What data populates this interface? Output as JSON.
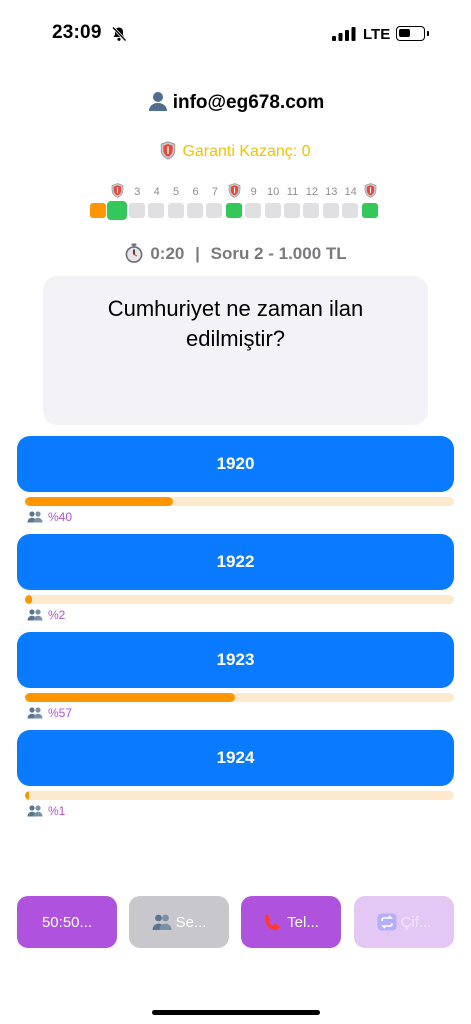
{
  "status_bar": {
    "time": "23:09",
    "network": "LTE"
  },
  "header": {
    "user_email": "info@eg678.com",
    "guarantee_text": "Garanti Kazanç: 0"
  },
  "ladder": {
    "levels": [
      {
        "label": "",
        "state": "done",
        "safe": false
      },
      {
        "label": "",
        "state": "current",
        "safe": true
      },
      {
        "label": "3",
        "state": "pending",
        "safe": false
      },
      {
        "label": "4",
        "state": "pending",
        "safe": false
      },
      {
        "label": "5",
        "state": "pending",
        "safe": false
      },
      {
        "label": "6",
        "state": "pending",
        "safe": false
      },
      {
        "label": "7",
        "state": "pending",
        "safe": false
      },
      {
        "label": "",
        "state": "safe",
        "safe": true
      },
      {
        "label": "9",
        "state": "pending",
        "safe": false
      },
      {
        "label": "10",
        "state": "pending",
        "safe": false
      },
      {
        "label": "11",
        "state": "pending",
        "safe": false
      },
      {
        "label": "12",
        "state": "pending",
        "safe": false
      },
      {
        "label": "13",
        "state": "pending",
        "safe": false
      },
      {
        "label": "14",
        "state": "pending",
        "safe": false
      },
      {
        "label": "",
        "state": "safe",
        "safe": true
      }
    ]
  },
  "timer": {
    "time": "0:20",
    "separator": "|",
    "question_info": "Soru 2 - 1.000 TL"
  },
  "question": {
    "text": "Cumhuriyet ne zaman ilan edilmiştir?"
  },
  "answers": [
    {
      "label": "1920",
      "percent": 40,
      "percent_text": "%40"
    },
    {
      "label": "1922",
      "percent": 2,
      "percent_text": "%2"
    },
    {
      "label": "1923",
      "percent": 57,
      "percent_text": "%57"
    },
    {
      "label": "1924",
      "percent": 1,
      "percent_text": "%1"
    }
  ],
  "jokers": [
    {
      "label": "50:50...",
      "icon": "",
      "color": "#af52de",
      "text_color": "#ffffff",
      "enabled": true
    },
    {
      "label": "Se...",
      "icon": "people-icon",
      "color": "#c7c7cc",
      "text_color": "#ffffff",
      "enabled": false
    },
    {
      "label": "Tel...",
      "icon": "phone-icon",
      "color": "#af52de",
      "text_color": "#ffffff",
      "enabled": true
    },
    {
      "label": "Çif...",
      "icon": "repeat-icon",
      "color": "#e3c7f4",
      "text_color": "#f2e6fa",
      "enabled": false
    }
  ],
  "colors": {
    "accent_blue": "#0a7bff",
    "bar_orange": "#ff9500",
    "bar_track": "#fde9cc",
    "purple": "#af52de",
    "green": "#34c759",
    "gold": "#f2c200"
  }
}
